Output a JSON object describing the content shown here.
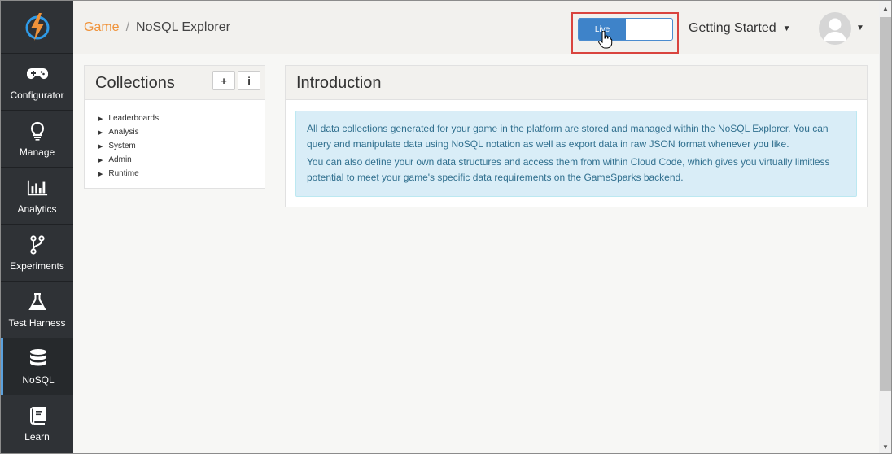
{
  "breadcrumb": {
    "game": "Game",
    "separator": "/",
    "current": "NoSQL Explorer"
  },
  "topbar": {
    "live_label": "Live",
    "getting_started": "Getting Started"
  },
  "sidebar": {
    "items": [
      {
        "label": "Configurator",
        "icon": "gamepad-icon"
      },
      {
        "label": "Manage",
        "icon": "lightbulb-icon"
      },
      {
        "label": "Analytics",
        "icon": "bar-chart-icon"
      },
      {
        "label": "Experiments",
        "icon": "branch-icon"
      },
      {
        "label": "Test Harness",
        "icon": "flask-icon"
      },
      {
        "label": "NoSQL",
        "icon": "database-icon"
      },
      {
        "label": "Learn",
        "icon": "book-icon"
      }
    ]
  },
  "collections": {
    "title": "Collections",
    "add_label": "+",
    "info_label": "i",
    "items": [
      "Leaderboards",
      "Analysis",
      "System",
      "Admin",
      "Runtime"
    ]
  },
  "intro": {
    "title": "Introduction",
    "paragraph1": "All data collections generated for your game in the platform are stored and managed within the NoSQL Explorer. You can query and manipulate data using NoSQL notation as well as export data in raw JSON format whenever you like.",
    "paragraph2": "You can also define your own data structures and access them from within Cloud Code, which gives you virtually limitless potential to meet your game's specific data requirements on the GameSparks backend."
  },
  "colors": {
    "accent": "#f0933a",
    "live_blue": "#3e83c9",
    "sidebar_bg": "#2f3236",
    "highlight_red": "#d9443f",
    "info_bg": "#d9edf7"
  }
}
